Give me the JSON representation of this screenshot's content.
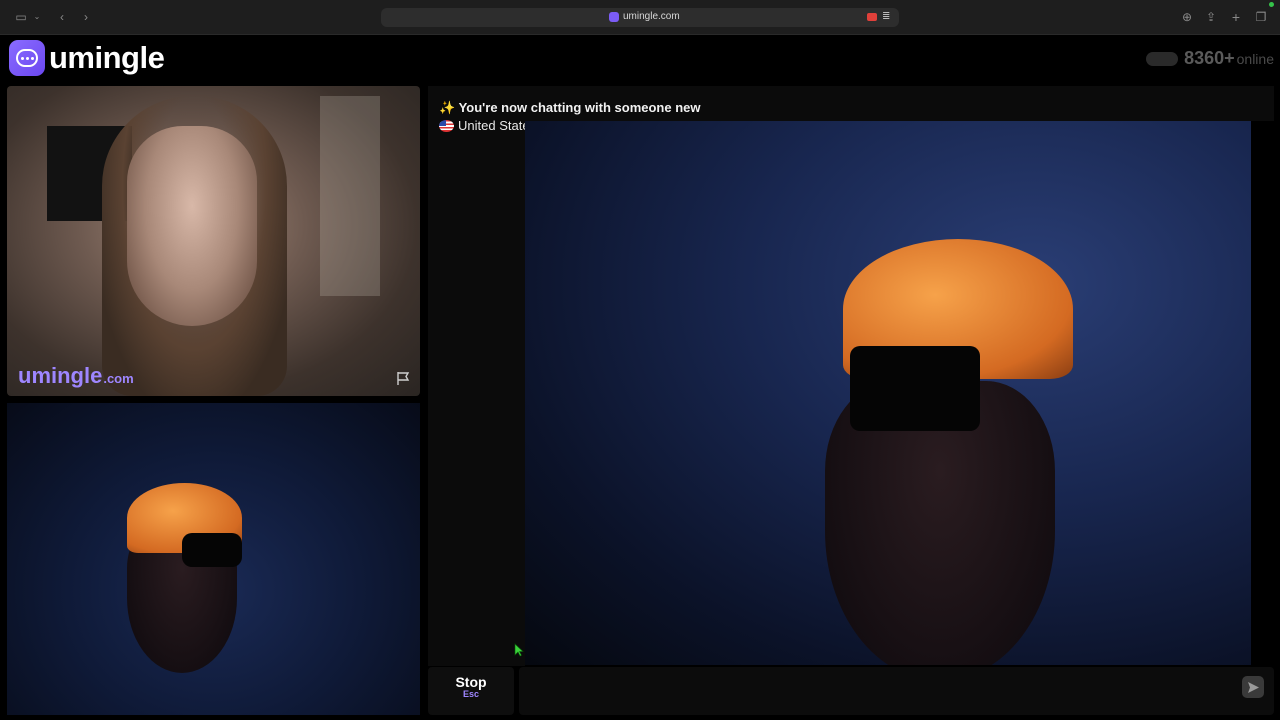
{
  "browser": {
    "url": "umingle.com"
  },
  "site": {
    "logo_text": "umingle",
    "online_count": "8360+",
    "online_label": "online"
  },
  "local_video": {
    "watermark_main": "umingle",
    "watermark_tld": ".com"
  },
  "chat": {
    "notice": "You're now chatting with someone new",
    "notice_icon": "sparkles-icon",
    "country": "United State",
    "country_flag": "us-flag-icon"
  },
  "controls": {
    "stop_label": "Stop",
    "stop_shortcut": "Esc",
    "message_placeholder": "",
    "send_icon": "send-icon"
  },
  "colors": {
    "brand": "#7b5cf5",
    "watermark": "#9e86ff",
    "background": "#000000"
  }
}
